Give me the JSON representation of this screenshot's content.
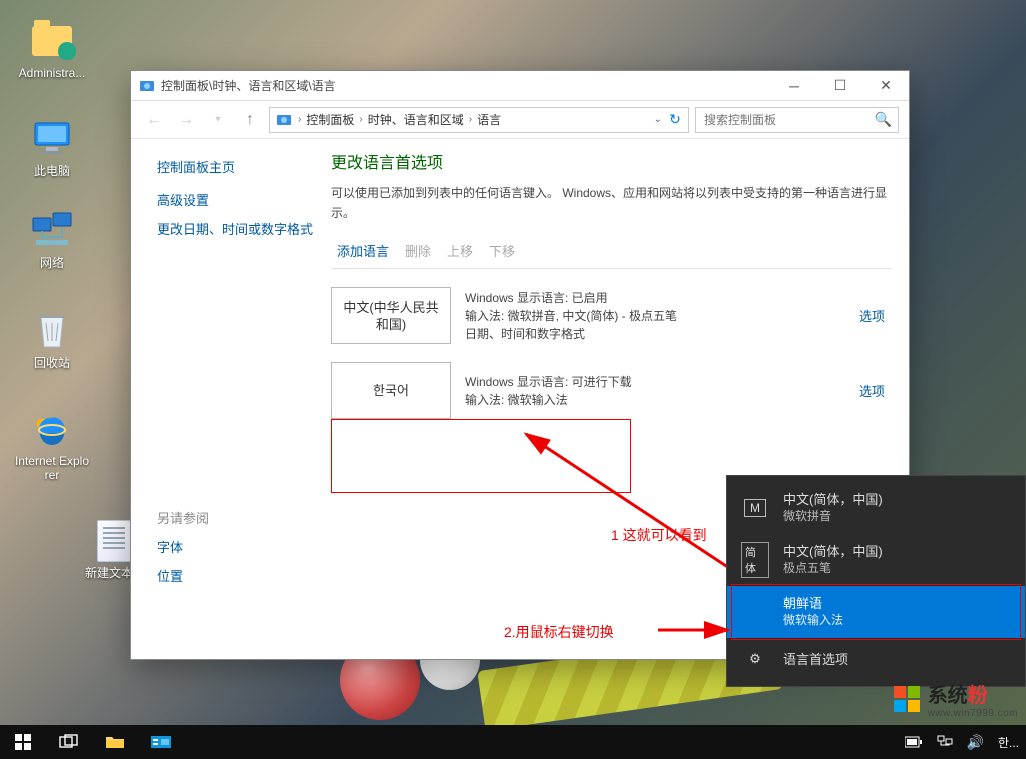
{
  "desktop": {
    "icons": {
      "admin": "Administra...",
      "pc": "此电脑",
      "network": "网络",
      "recycle": "回收站",
      "ie": "Internet Explorer",
      "txt": "新建文本..."
    }
  },
  "window": {
    "title": "控制面板\\时钟、语言和区域\\语言",
    "breadcrumb": {
      "b1": "控制面板",
      "b2": "时钟、语言和区域",
      "b3": "语言"
    },
    "search_placeholder": "搜索控制面板",
    "sidebar": {
      "home": "控制面板主页",
      "advanced": "高级设置",
      "datefmt": "更改日期、时间或数字格式",
      "seealso": "另请参阅",
      "font": "字体",
      "location": "位置"
    },
    "main": {
      "heading": "更改语言首选项",
      "desc": "可以使用已添加到列表中的任何语言键入。 Windows、应用和网站将以列表中受支持的第一种语言进行显示。",
      "actions": {
        "add": "添加语言",
        "remove": "删除",
        "up": "上移",
        "down": "下移"
      },
      "lang1": {
        "name": "中文(中华人民共和国)",
        "l1": "Windows 显示语言: 已启用",
        "l2": "输入法: 微软拼音, 中文(简体) - 极点五笔",
        "l3": "日期、时间和数字格式",
        "opt": "选项"
      },
      "lang2": {
        "name": "한국어",
        "l1": "Windows 显示语言: 可进行下载",
        "l2": "输入法: 微软输入法",
        "opt": "选项"
      }
    }
  },
  "annotations": {
    "a1": "1 这就可以看到",
    "a2": "2.用鼠标右键切换"
  },
  "ime": {
    "r1": {
      "name": "中文(简体，中国)",
      "sub": "微软拼音"
    },
    "r2": {
      "icon": "简体",
      "name": "中文(简体，中国)",
      "sub": "极点五笔"
    },
    "r3": {
      "name": "朝鲜语",
      "sub": "微软输入法"
    },
    "r4": {
      "name": "语言首选项"
    }
  },
  "taskbar": {
    "ime_label": "한..."
  },
  "watermark": {
    "t1": "系统",
    "t2": "粉",
    "url": "www.win7999.com"
  }
}
